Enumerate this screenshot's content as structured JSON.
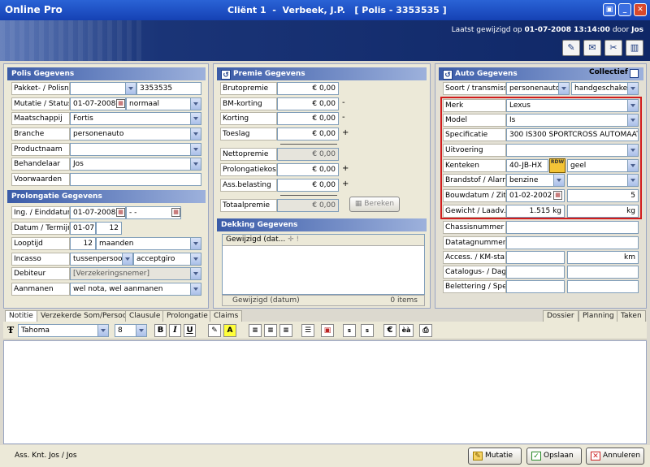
{
  "titlebar": {
    "app_name": "Online Pro",
    "window_title": "Cliënt 1  -  Verbeek, J.P.   [ Polis - 3353535 ]"
  },
  "header": {
    "last_modified_prefix": "Laatst gewijzigd op ",
    "last_modified_date": "01-07-2008 13:14:00",
    "last_modified_by_prefix": " door ",
    "last_modified_user": "Jos"
  },
  "polis": {
    "title": "Polis Gegevens",
    "pakket_label": "Pakket- / Polisnr.",
    "pakket_value": "",
    "polisnr_value": "3353535",
    "mutatie_label": "Mutatie / Status",
    "mutatie_date": "01-07-2008",
    "status_value": "normaal",
    "maatschappij_label": "Maatschappij",
    "maatschappij_value": "Fortis",
    "branche_label": "Branche",
    "branche_value": "personenauto",
    "productnaam_label": "Productnaam",
    "productnaam_value": "",
    "behandelaar_label": "Behandelaar",
    "behandelaar_value": "Jos",
    "voorwaarden_label": "Voorwaarden",
    "voorwaarden_value": ""
  },
  "prolongatie": {
    "title": "Prolongatie Gegevens",
    "ing_label": "Ing. / Einddatum",
    "ing_value": "01-07-2008",
    "eind_value": "- -",
    "termijn_label": "Datum / Termijn",
    "datum_value": "01-07",
    "termijn_value": "12",
    "looptijd_label": "Looptijd",
    "looptijd_value": "12",
    "looptijd_unit": "maanden",
    "incasso_label": "Incasso",
    "incasso_value": "tussenpersoon",
    "incasso_type": "acceptgiro",
    "debiteur_label": "Debiteur",
    "debiteur_value": "[Verzekeringsnemer]",
    "aanmanen_label": "Aanmanen",
    "aanmanen_value": "wel nota, wel aanmanen"
  },
  "premie": {
    "title": "Premie Gegevens",
    "brutopremie_label": "Brutopremie",
    "brutopremie_value": "€ 0,00",
    "bm_label": "BM-korting",
    "bm_value": "€ 0,00",
    "bm_sign": "-",
    "korting_label": "Korting",
    "korting_value": "€ 0,00",
    "korting_sign": "-",
    "toeslag_label": "Toeslag",
    "toeslag_value": "€ 0,00",
    "toeslag_sign": "+",
    "netto_label": "Nettopremie",
    "netto_value": "€ 0,00",
    "prolongatiekosten_label": "Prolongatiekosten",
    "prolongatiekosten_value": "€ 0,00",
    "prolongatiekosten_sign": "+",
    "assbel_label": "Ass.belasting",
    "assbel_value": "€ 0,00",
    "assbel_sign": "+",
    "totaal_label": "Totaalpremie",
    "totaal_value": "€ 0,00",
    "bereken_label": "Bereken"
  },
  "dekking": {
    "title": "Dekking Gegevens",
    "column_header": "Gewijzigd (dat...",
    "footer_label": "Gewijzigd (datum)",
    "footer_count": "0 items"
  },
  "auto": {
    "title": "Auto Gegevens",
    "collectief_label": "Collectief",
    "soort_label": "Soort / transmissie",
    "soort_value": "personenauto",
    "transmissie_value": "handgeschakeld",
    "merk_label": "Merk",
    "merk_value": "Lexus",
    "model_label": "Model",
    "model_value": "Is",
    "spec_label": "Specificatie",
    "spec_value": "300 IS300 SPORTCROSS AUTOMAAT",
    "uitvoering_label": "Uitvoering",
    "uitvoering_value": "",
    "kenteken_label": "Kenteken",
    "kenteken_value": "40-JB-HX",
    "kleur_value": "geel",
    "rdw_label": "RDW",
    "brandstof_label": "Brandstof / Alarm",
    "brandstof_value": "benzine",
    "alarm_value": "",
    "bouwdatum_label": "Bouwdatum / Zitpl.",
    "bouwdatum_value": "01-02-2002",
    "zitpl_value": "5",
    "gewicht_label": "Gewicht / Laadv.",
    "gewicht_value": "1.515 kg",
    "laadv_value": "kg",
    "chassis_label": "Chassisnummer",
    "chassis_value": "",
    "datatag_label": "Datatagnummer",
    "datatag_value": "",
    "access_label": "Access. / KM-stand",
    "access_value": "",
    "km_value": "km",
    "catalogus_label": "Catalogus- / Dagw.",
    "catalogus_value": "",
    "dagw_value": "",
    "belettering_label": "Belettering / Spec.",
    "belettering_value": "",
    "belettering_spec": ""
  },
  "right_tabs": [
    "Dossier",
    "Planning",
    "Taken"
  ],
  "tabs": [
    "Notitie",
    "Verzekerde Som/Persoon",
    "Clausule",
    "Prolongatie",
    "Claims"
  ],
  "editor": {
    "font_name": "Tahoma",
    "font_size": "8"
  },
  "status": {
    "text": "Ass. Knt. Jos / Jos"
  },
  "buttons": {
    "mutatie": "Mutatie",
    "opslaan": "Opslaan",
    "annuleren": "Annuleren"
  }
}
